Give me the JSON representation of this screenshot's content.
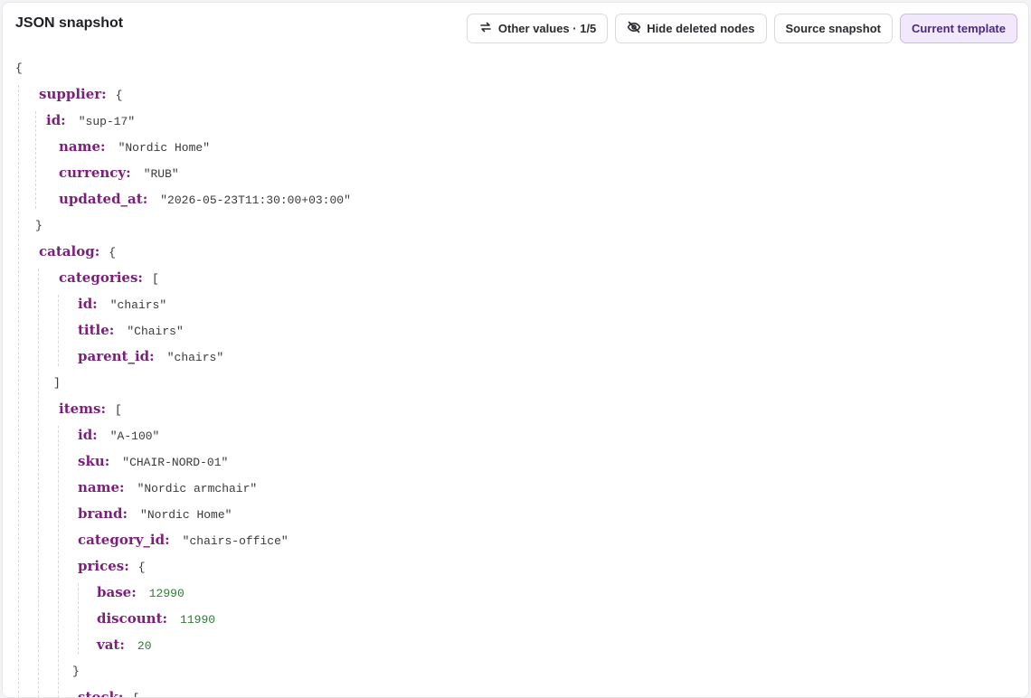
{
  "header": {
    "title": "JSON snapshot",
    "buttons": {
      "other_values": "Other values · 1/5",
      "hide_deleted": "Hide deleted nodes",
      "source_snapshot": "Source snapshot",
      "current_template": "Current template"
    }
  },
  "colors": {
    "key": "#7b1f7a",
    "number": "#2f7a39",
    "active_button_bg": "#f1e9fb"
  },
  "icons": [
    "refresh-icon",
    "eye-off-icon"
  ],
  "lines": [
    {
      "punct": "{"
    },
    {
      "key": "supplier:",
      "punct": "{"
    },
    {
      "key": "id:",
      "value": "\"sup-17\"",
      "vtype": "str"
    },
    {
      "key": "name:",
      "value": "\"Nordic Home\"",
      "vtype": "str"
    },
    {
      "key": "currency:",
      "value": "\"RUB\"",
      "vtype": "str"
    },
    {
      "key": "updated_at:",
      "value": "\"2026-05-23T11:30:00+03:00\"",
      "vtype": "str"
    },
    {
      "punct": "}"
    },
    {
      "key": "catalog:",
      "punct": "{"
    },
    {
      "key": "categories:",
      "punct": "["
    },
    {
      "key": "id:",
      "value": "\"chairs\"",
      "vtype": "str"
    },
    {
      "key": "title:",
      "value": "\"Chairs\"",
      "vtype": "str"
    },
    {
      "key": "parent_id:",
      "value": "\"chairs\"",
      "vtype": "str"
    },
    {
      "punct": "]"
    },
    {
      "key": "items:",
      "punct": "["
    },
    {
      "key": "id:",
      "value": "\"A-100\"",
      "vtype": "str"
    },
    {
      "key": "sku:",
      "value": "\"CHAIR-NORD-01\"",
      "vtype": "str"
    },
    {
      "key": "name:",
      "value": "\"Nordic armchair\"",
      "vtype": "str"
    },
    {
      "key": "brand:",
      "value": "\"Nordic Home\"",
      "vtype": "str"
    },
    {
      "key": "category_id:",
      "value": "\"chairs-office\"",
      "vtype": "str"
    },
    {
      "key": "prices:",
      "punct": "{"
    },
    {
      "key": "base:",
      "value": "12990",
      "vtype": "num"
    },
    {
      "key": "discount:",
      "value": "11990",
      "vtype": "num"
    },
    {
      "key": "vat:",
      "value": "20",
      "vtype": "num"
    },
    {
      "punct": "}"
    },
    {
      "key": "stock:",
      "punct": "["
    }
  ]
}
